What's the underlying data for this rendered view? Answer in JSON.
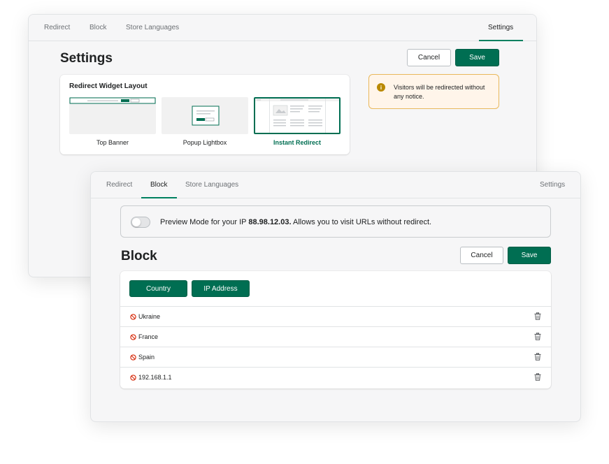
{
  "settings_window": {
    "tabs": [
      {
        "label": "Redirect"
      },
      {
        "label": "Block"
      },
      {
        "label": "Store Languages"
      },
      {
        "label": "Settings",
        "active": true
      }
    ],
    "title": "Settings",
    "cancel_label": "Cancel",
    "save_label": "Save",
    "layout_card": {
      "title": "Redirect Widget Layout",
      "options": [
        {
          "label": "Top Banner",
          "selected": false
        },
        {
          "label": "Popup Lightbox",
          "selected": false
        },
        {
          "label": "Instant Redirect",
          "selected": true
        }
      ]
    },
    "notice": {
      "icon": "info-icon",
      "text": "Visitors will be redirected without any notice."
    }
  },
  "block_window": {
    "tabs": [
      {
        "label": "Redirect"
      },
      {
        "label": "Block",
        "active": true
      },
      {
        "label": "Store Languages"
      },
      {
        "label": "Settings"
      }
    ],
    "preview": {
      "prefix": "Preview Mode for your IP ",
      "ip": "88.98.12.03.",
      "suffix": " Allows you to visit URLs without redirect.",
      "enabled": false
    },
    "title": "Block",
    "cancel_label": "Cancel",
    "save_label": "Save",
    "filter_buttons": [
      {
        "label": "Country"
      },
      {
        "label": "IP Address"
      }
    ],
    "blocked_items": [
      {
        "label": "Ukraine"
      },
      {
        "label": "France"
      },
      {
        "label": "Spain"
      },
      {
        "label": "192.168.1.1"
      }
    ]
  },
  "colors": {
    "accent": "#006e52",
    "block_icon": "#d72c0d",
    "notice_bg": "#fff5ea",
    "notice_border": "#e9b85b"
  }
}
